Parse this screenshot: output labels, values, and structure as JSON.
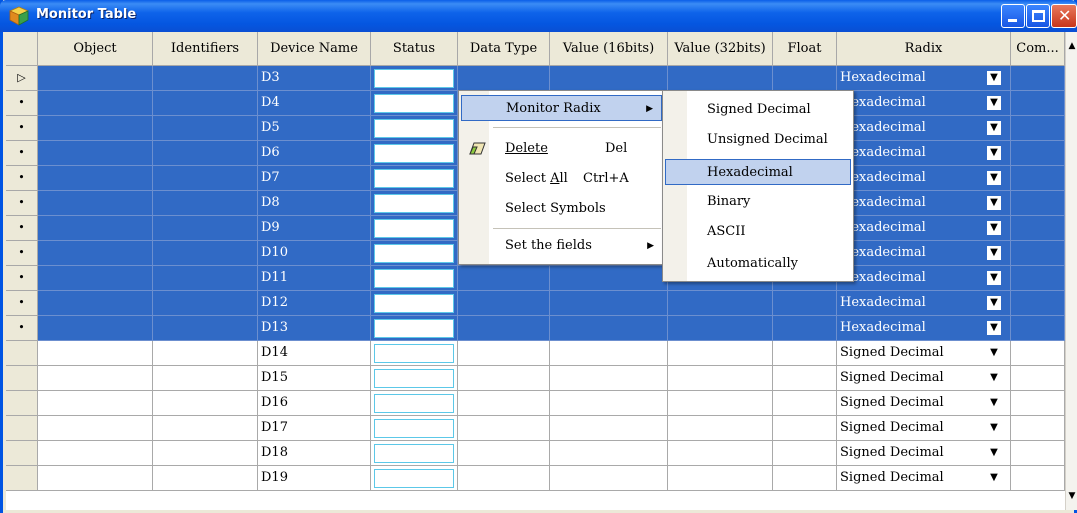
{
  "window": {
    "title": "Monitor Table",
    "icon": "package-icon"
  },
  "columns": [
    "Object",
    "Identifiers",
    "Device Name",
    "Status",
    "Data Type",
    "Value (16bits)",
    "Value (32bits)",
    "Float",
    "Radix",
    "Com..."
  ],
  "rows": [
    {
      "indicator": "▷",
      "device": "D3",
      "radix": "Hexadecimal",
      "selected": true
    },
    {
      "indicator": "•",
      "device": "D4",
      "radix": "Hexadecimal",
      "selected": true
    },
    {
      "indicator": "•",
      "device": "D5",
      "radix": "Hexadecimal",
      "selected": true
    },
    {
      "indicator": "•",
      "device": "D6",
      "radix": "Hexadecimal",
      "selected": true
    },
    {
      "indicator": "•",
      "device": "D7",
      "radix": "Hexadecimal",
      "selected": true
    },
    {
      "indicator": "•",
      "device": "D8",
      "radix": "Hexadecimal",
      "selected": true
    },
    {
      "indicator": "•",
      "device": "D9",
      "radix": "Hexadecimal",
      "selected": true
    },
    {
      "indicator": "•",
      "device": "D10",
      "radix": "Hexadecimal",
      "selected": true
    },
    {
      "indicator": "•",
      "device": "D11",
      "radix": "Hexadecimal",
      "selected": true
    },
    {
      "indicator": "•",
      "device": "D12",
      "radix": "Hexadecimal",
      "selected": true
    },
    {
      "indicator": "•",
      "device": "D13",
      "radix": "Hexadecimal",
      "selected": true
    },
    {
      "indicator": "",
      "device": "D14",
      "radix": "Signed Decimal",
      "selected": false
    },
    {
      "indicator": "",
      "device": "D15",
      "radix": "Signed Decimal",
      "selected": false
    },
    {
      "indicator": "",
      "device": "D16",
      "radix": "Signed Decimal",
      "selected": false
    },
    {
      "indicator": "",
      "device": "D17",
      "radix": "Signed Decimal",
      "selected": false
    },
    {
      "indicator": "",
      "device": "D18",
      "radix": "Signed Decimal",
      "selected": false
    },
    {
      "indicator": "",
      "device": "D19",
      "radix": "Signed Decimal",
      "selected": false
    }
  ],
  "context_menu": {
    "monitor_radix": "Monitor Radix",
    "delete": "Delete",
    "delete_shortcut": "Del",
    "select_all_pre": "Select ",
    "select_all_key": "A",
    "select_all_post": "ll",
    "select_all_shortcut": "Ctrl+A",
    "select_symbols": "Select Symbols",
    "set_fields": "Set the fields"
  },
  "radix_submenu": {
    "items": [
      "Signed Decimal",
      "Unsigned Decimal",
      "Hexadecimal",
      "Binary",
      "ASCII",
      "Automatically"
    ],
    "highlighted": "Hexadecimal"
  },
  "colors": {
    "selection": "#316ac5",
    "titlebar": "#0a5ee8",
    "menu_highlight": "#c1d2ee"
  }
}
